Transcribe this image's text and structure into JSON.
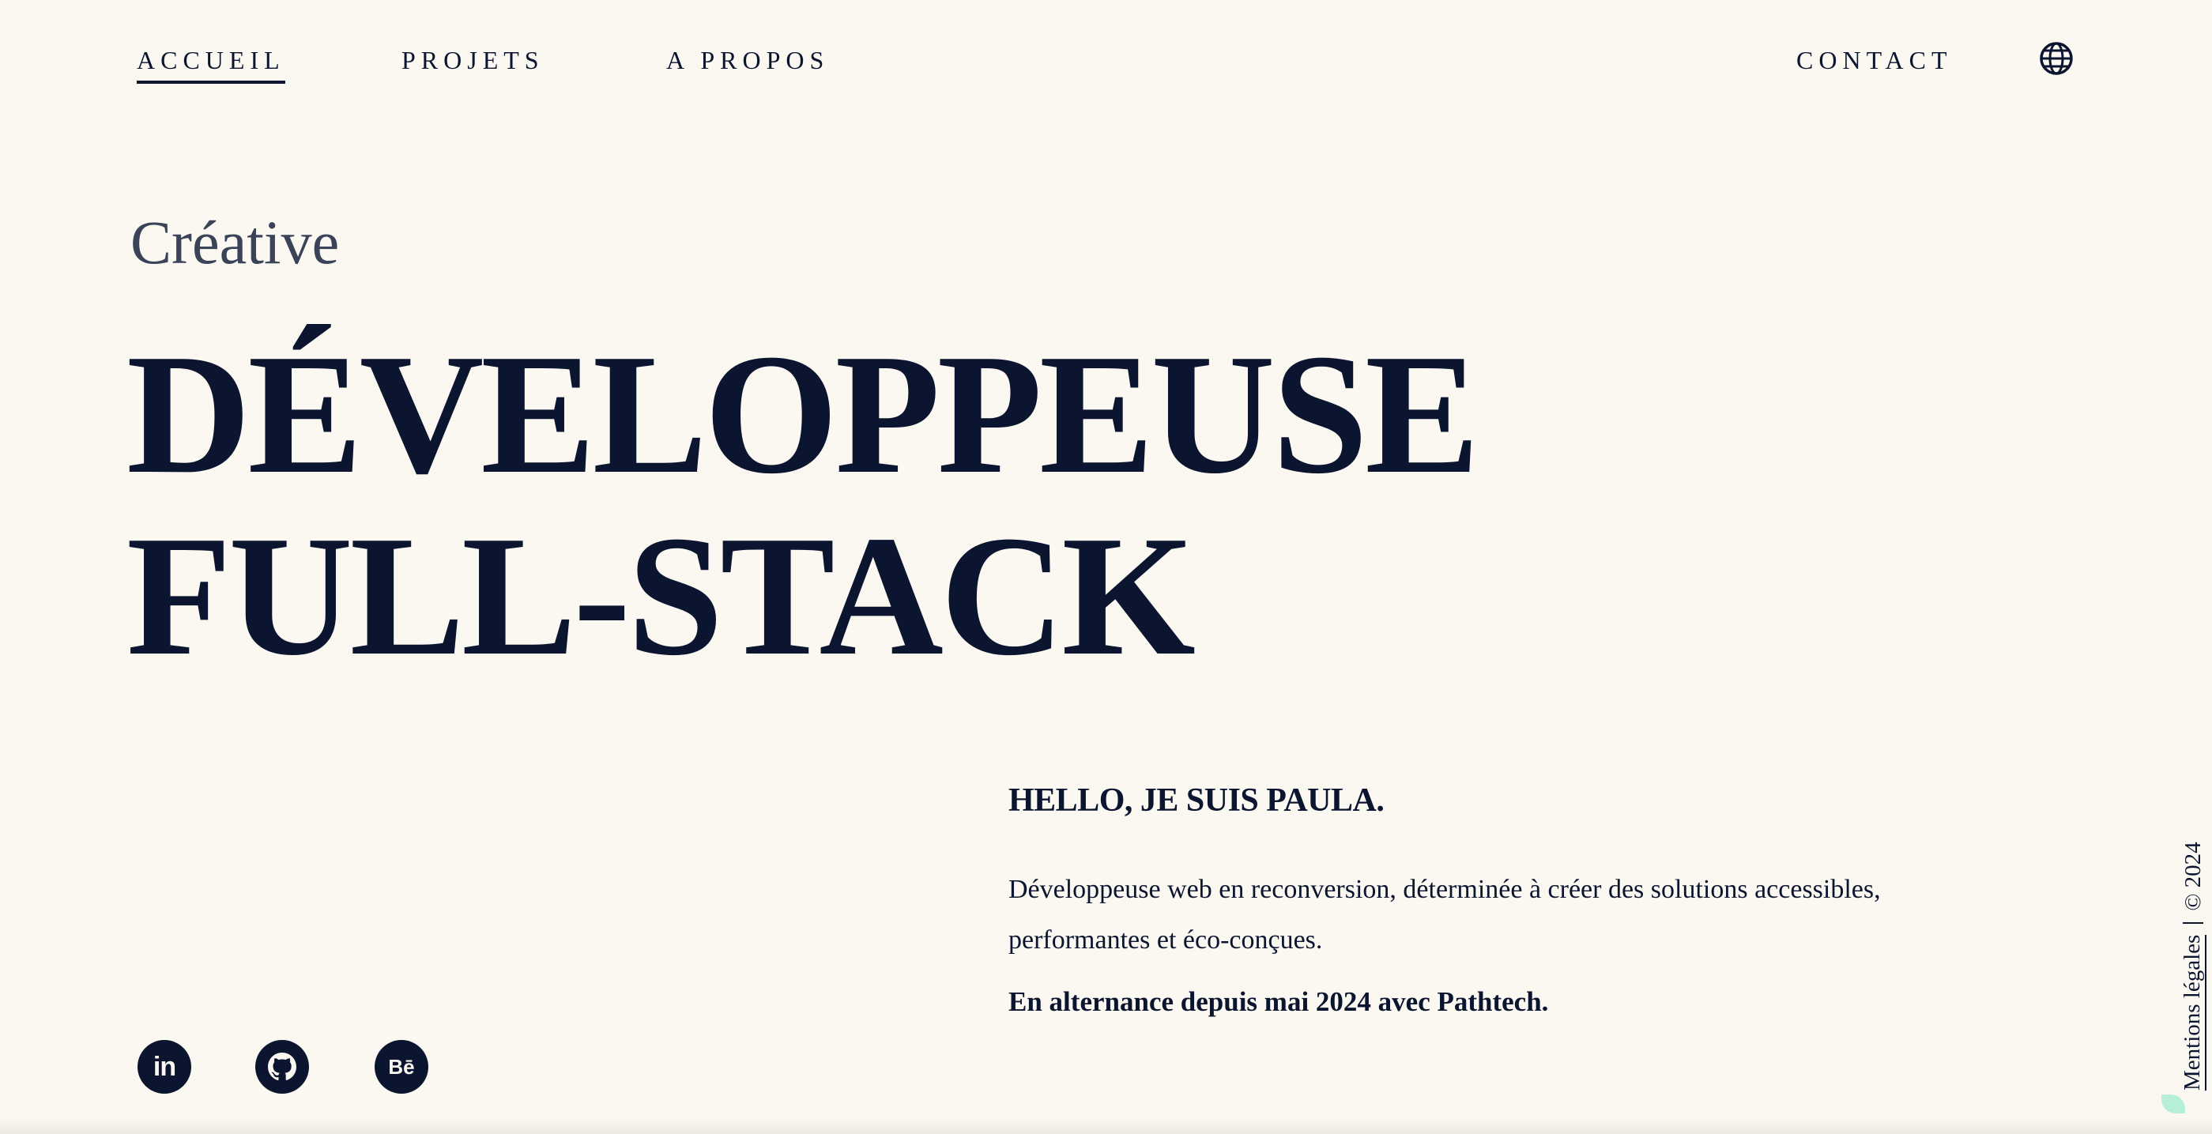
{
  "nav": {
    "items": [
      {
        "label": "ACCUEIL",
        "active": true
      },
      {
        "label": "PROJETS",
        "active": false
      },
      {
        "label": "A PROPOS",
        "active": false
      }
    ],
    "contact_label": "CONTACT",
    "language_icon": "globe-icon"
  },
  "hero": {
    "kicker": "Créative",
    "headline_line1": "DÉVELOPPEUSE",
    "headline_line2": "FULL-STACK"
  },
  "intro": {
    "title": "HELLO, JE SUIS PAULA.",
    "text": "Développeuse web en reconversion, déterminée à créer des solutions accessibles, performantes et éco-conçues.",
    "highlight": "En alternance depuis mai 2024 avec Pathtech."
  },
  "social": [
    {
      "icon": "linkedin-icon",
      "label": "in"
    },
    {
      "icon": "github-icon",
      "label": ""
    },
    {
      "icon": "behance-icon",
      "label": "Bē"
    }
  ],
  "footer": {
    "legal_label": "Mentions légales",
    "copyright": "© 2024"
  },
  "colors": {
    "background": "#faf8f1",
    "ink": "#0c1530",
    "accent": "#b7efd9"
  }
}
